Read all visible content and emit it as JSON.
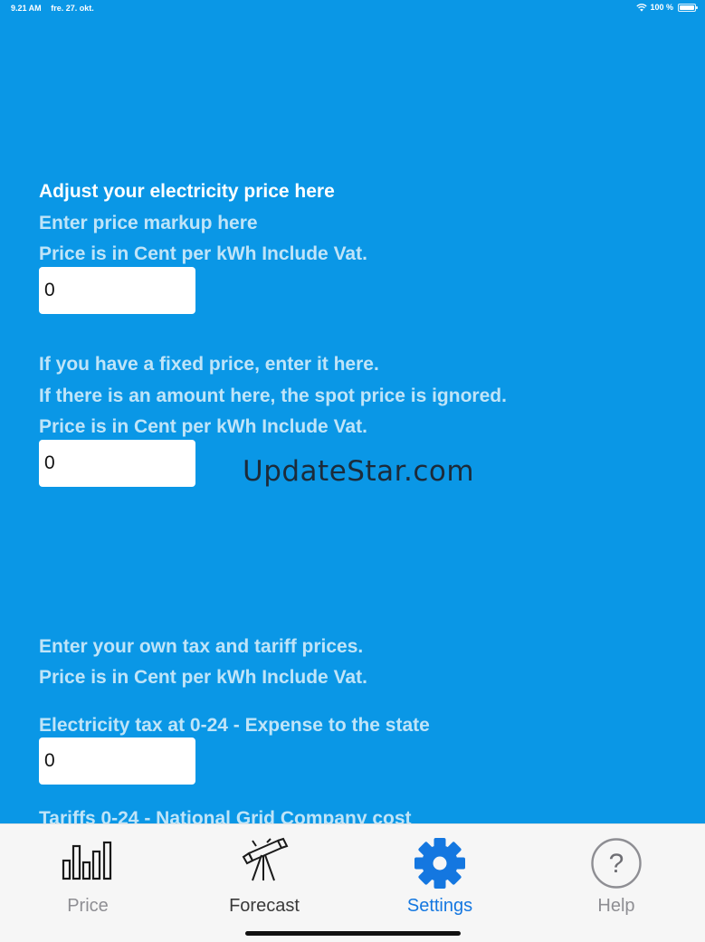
{
  "status_bar": {
    "time": "9.21 AM",
    "date": "fre. 27. okt.",
    "battery": "100 %"
  },
  "settings": {
    "heading": "Adjust your electricity price here",
    "markup_label": "Enter price markup here",
    "markup_unit": "Price is in Cent per kWh Include Vat.",
    "markup_value": "0",
    "fixed_label_1": "If you have a fixed price, enter it here.",
    "fixed_label_2": "If there is an amount here, the spot price is ignored.",
    "fixed_unit": "Price is in Cent per kWh Include Vat.",
    "fixed_value": "0",
    "tax_intro": "Enter your own tax and tariff prices.",
    "tax_unit": "Price is in Cent per kWh Include Vat.",
    "electricity_tax_label": "Electricity tax at 0-24 - Expense to the state",
    "electricity_tax_value": "0",
    "tariffs_label": "Tariffs 0-24 - National Grid Company cost"
  },
  "watermark": "UpdateStar.com",
  "tab_bar": {
    "tabs": [
      {
        "label": "Price",
        "icon": "bar-chart-icon"
      },
      {
        "label": "Forecast",
        "icon": "telescope-icon"
      },
      {
        "label": "Settings",
        "icon": "gear-icon"
      },
      {
        "label": "Help",
        "icon": "question-icon"
      }
    ],
    "active": "Settings"
  },
  "colors": {
    "background": "#0a97e6",
    "accent": "#1477e0",
    "label_text": "#bfe4f8",
    "tab_bar_bg": "#f6f6f6"
  }
}
